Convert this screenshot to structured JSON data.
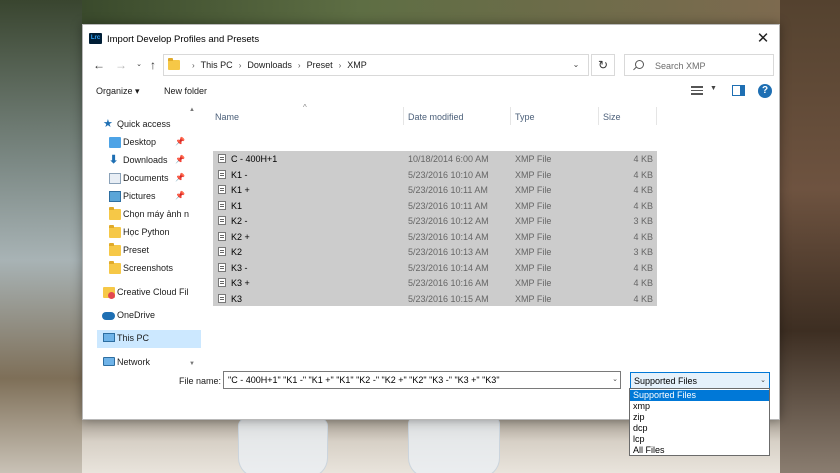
{
  "dialog": {
    "title": "Import Develop Profiles and Presets",
    "app_icon": "Lrc",
    "close_glyph": "✕"
  },
  "address": {
    "crumbs": [
      "This PC",
      "Downloads",
      "Preset",
      "XMP"
    ]
  },
  "search": {
    "placeholder": "Search XMP"
  },
  "toolbar": {
    "organize_label": "Organize ▾",
    "new_folder_label": "New folder"
  },
  "nav": {
    "items": [
      {
        "label": "Quick access",
        "icon": "star-icon"
      },
      {
        "label": "Desktop",
        "icon": "desktop-icon",
        "pinned": true
      },
      {
        "label": "Downloads",
        "icon": "download-icon",
        "pinned": true
      },
      {
        "label": "Documents",
        "icon": "documents-icon",
        "pinned": true
      },
      {
        "label": "Pictures",
        "icon": "pictures-icon",
        "pinned": true
      },
      {
        "label": "Chọn máy ảnh n",
        "icon": "folder-icon"
      },
      {
        "label": "Học Python",
        "icon": "folder-icon"
      },
      {
        "label": "Preset",
        "icon": "folder-icon"
      },
      {
        "label": "Screenshots",
        "icon": "folder-icon"
      },
      {
        "label": "Creative Cloud Fil",
        "icon": "creative-cloud-icon"
      },
      {
        "label": "OneDrive",
        "icon": "onedrive-icon"
      },
      {
        "label": "This PC",
        "icon": "this-pc-icon",
        "selected": true
      },
      {
        "label": "Network",
        "icon": "network-icon"
      }
    ]
  },
  "columns": {
    "name": "Name",
    "date": "Date modified",
    "type": "Type",
    "size": "Size"
  },
  "files": [
    {
      "name": "C - 400H+1",
      "date": "10/18/2014 6:00 AM",
      "type": "XMP File",
      "size": "4 KB"
    },
    {
      "name": "K1 -",
      "date": "5/23/2016 10:10 AM",
      "type": "XMP File",
      "size": "4 KB"
    },
    {
      "name": "K1 +",
      "date": "5/23/2016 10:11 AM",
      "type": "XMP File",
      "size": "4 KB"
    },
    {
      "name": "K1",
      "date": "5/23/2016 10:11 AM",
      "type": "XMP File",
      "size": "4 KB"
    },
    {
      "name": "K2 -",
      "date": "5/23/2016 10:12 AM",
      "type": "XMP File",
      "size": "3 KB"
    },
    {
      "name": "K2 +",
      "date": "5/23/2016 10:14 AM",
      "type": "XMP File",
      "size": "4 KB"
    },
    {
      "name": "K2",
      "date": "5/23/2016 10:13 AM",
      "type": "XMP File",
      "size": "3 KB"
    },
    {
      "name": "K3 -",
      "date": "5/23/2016 10:14 AM",
      "type": "XMP File",
      "size": "4 KB"
    },
    {
      "name": "K3 +",
      "date": "5/23/2016 10:16 AM",
      "type": "XMP File",
      "size": "4 KB"
    },
    {
      "name": "K3",
      "date": "5/23/2016 10:15 AM",
      "type": "XMP File",
      "size": "4 KB"
    }
  ],
  "filename": {
    "label": "File name:",
    "value": "\"C - 400H+1\" \"K1 -\" \"K1 +\" \"K1\" \"K2 -\" \"K2 +\" \"K2\" \"K3 -\" \"K3 +\" \"K3\""
  },
  "filetype": {
    "selected": "Supported Files",
    "options": [
      "Supported Files",
      "xmp",
      "zip",
      "dcp",
      "lcp",
      "All Files"
    ]
  },
  "colors": {
    "accent": "#0078d7",
    "selection_row": "#cccccc",
    "nav_selected": "#cce8ff"
  }
}
